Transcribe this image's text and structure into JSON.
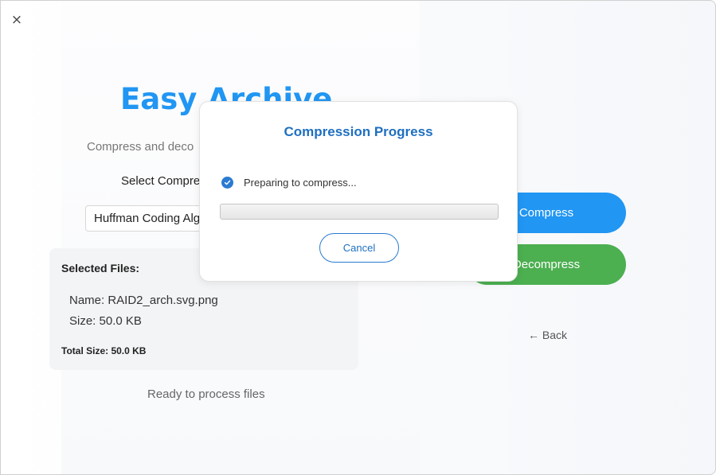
{
  "window": {
    "close_label": "×"
  },
  "app": {
    "title": "Easy Archive",
    "subtitle": "Compress and deco",
    "algo_label": "Select Compre",
    "algo_selected": "Huffman Coding Alg"
  },
  "files": {
    "title": "Selected Files:",
    "name_line": "Name: RAID2_arch.svg.png",
    "size_line": "Size: 50.0 KB",
    "total": "Total Size: 50.0 KB"
  },
  "status": "Ready to process files",
  "actions": {
    "compress": "Compress",
    "decompress": "Decompress",
    "back": "← Back"
  },
  "dialog": {
    "title": "Compression Progress",
    "message": "Preparing to compress...",
    "progress": 0,
    "cancel": "Cancel"
  },
  "colors": {
    "primary": "#2196f3",
    "success": "#4caf50",
    "dialog_accent": "#1e6fc0"
  },
  "icons": {
    "close": "close-icon",
    "progress_status": "check-circle-icon"
  }
}
